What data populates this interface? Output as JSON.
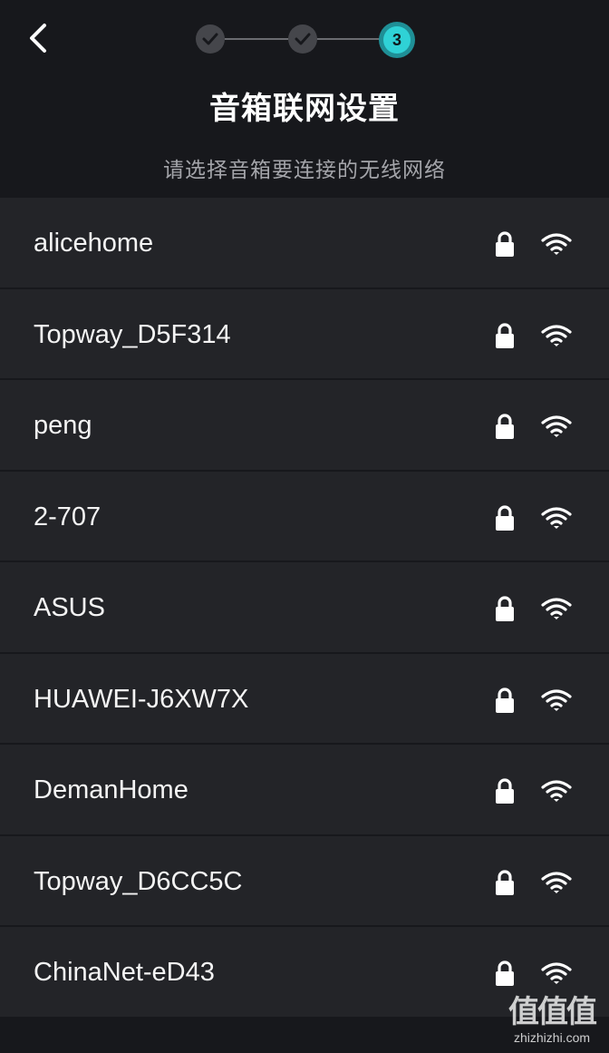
{
  "header": {
    "title": "音箱联网设置",
    "subtitle": "请选择音箱要连接的无线网络",
    "current_step": "3"
  },
  "colors": {
    "accent": "#2fd2d6",
    "background": "#17181c",
    "row_background": "#232428"
  },
  "networks": [
    {
      "name": "alicehome",
      "locked": true,
      "signal": "full"
    },
    {
      "name": "Topway_D5F314",
      "locked": true,
      "signal": "full"
    },
    {
      "name": "peng",
      "locked": true,
      "signal": "full"
    },
    {
      "name": "2-707",
      "locked": true,
      "signal": "full"
    },
    {
      "name": "ASUS",
      "locked": true,
      "signal": "full"
    },
    {
      "name": "HUAWEI-J6XW7X",
      "locked": true,
      "signal": "full"
    },
    {
      "name": "DemanHome",
      "locked": true,
      "signal": "full"
    },
    {
      "name": "Topway_D6CC5C",
      "locked": true,
      "signal": "full"
    },
    {
      "name": "ChinaNet-eD43",
      "locked": true,
      "signal": "full"
    }
  ],
  "watermark": {
    "logo_text": "值值值",
    "site": "zhizhizhi.com"
  }
}
